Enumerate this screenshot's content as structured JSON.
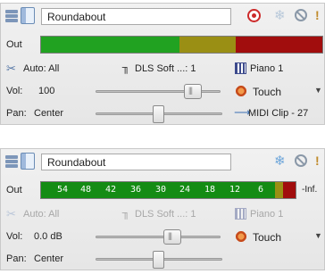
{
  "panels": [
    {
      "track_name": "Roundabout",
      "meter_label": "Out",
      "automation_label": "Auto: All",
      "synth_label": "DLS Soft ...: 1",
      "patch_label": "Piano 1",
      "vol_label": "Vol:",
      "vol_value": "100",
      "vol_level": 0.54,
      "automation_mode": "Touch",
      "pan_label": "Pan:",
      "pan_value": "Center",
      "pan_level": 0.5,
      "output_label": "MIDI Clip - 27"
    },
    {
      "track_name": "Roundabout",
      "meter_label": "Out",
      "meter_ticks": [
        "54",
        "48",
        "42",
        "36",
        "30",
        "24",
        "18",
        "12",
        "6"
      ],
      "peak_label": "-Inf.",
      "automation_label": "Auto: All",
      "synth_label": "DLS Soft ...: 1",
      "patch_label": "Piano 1",
      "vol_label": "Vol:",
      "vol_value": "0.0 dB",
      "vol_level": 0.54,
      "automation_mode": "Touch",
      "pan_label": "Pan:",
      "pan_value": "Center",
      "pan_level": 0.5
    }
  ],
  "colors": {
    "meter_green": "#21a221",
    "meter_yellow": "#9a8f14",
    "meter_red": "#a10d0d",
    "record_red": "#cc2a2a"
  }
}
